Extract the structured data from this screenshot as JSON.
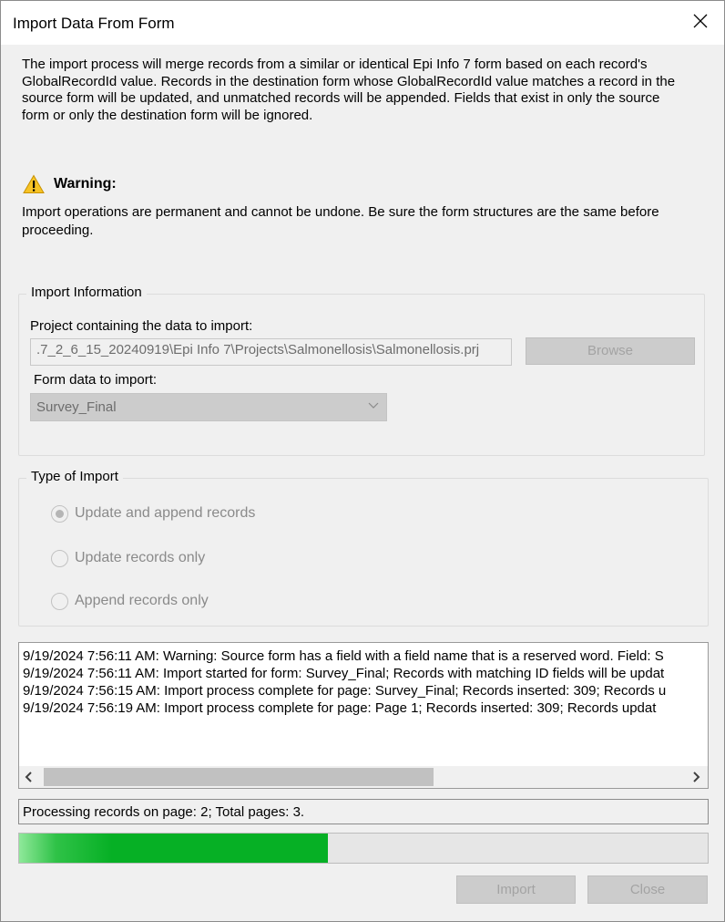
{
  "window": {
    "title": "Import Data From Form"
  },
  "description": "The import process will merge records from a similar or identical Epi Info 7 form based on each record's GlobalRecordId value. Records in the destination form whose GlobalRecordId value matches a record in the source form will be updated, and unmatched records will be appended. Fields that exist in only the source form or only the destination form will be ignored.",
  "warning": {
    "icon": "warning-triangle-icon",
    "title": "Warning:",
    "text": "Import operations are permanent and cannot be undone. Be sure the form structures are the same before proceeding."
  },
  "import_info": {
    "group_label": "Import Information",
    "project_label": "Project containing the data to import:",
    "project_path": ".7_2_6_15_20240919\\Epi Info 7\\Projects\\Salmonellosis\\Salmonellosis.prj",
    "browse_label": "Browse",
    "form_label": "Form data to import:",
    "form_selected": "Survey_Final"
  },
  "import_type": {
    "group_label": "Type of Import",
    "options": [
      {
        "label": "Update and append records",
        "checked": true
      },
      {
        "label": "Update records only",
        "checked": false
      },
      {
        "label": "Append records only",
        "checked": false
      }
    ]
  },
  "log": {
    "lines": [
      "9/19/2024 7:56:11 AM: Warning: Source form has a field with a field name that is a reserved word. Field: S",
      "9/19/2024 7:56:11 AM: Import started for form: Survey_Final; Records with matching ID fields will be updat",
      "9/19/2024 7:56:15 AM: Import process complete for page: Survey_Final; Records inserted: 309; Records u",
      "9/19/2024 7:56:19 AM: Import process complete for page: Page 1; Records inserted: 309; Records updat"
    ]
  },
  "status_text": "Processing records on page: 2; Total pages: 3.",
  "progress": {
    "fraction": 0.449,
    "color": "#06b025"
  },
  "buttons": {
    "import_label": "Import",
    "close_label": "Close"
  }
}
